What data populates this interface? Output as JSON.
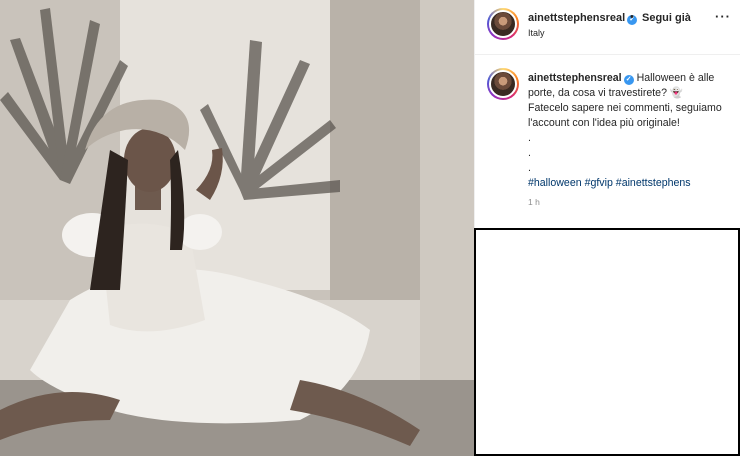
{
  "post": {
    "image_alt": "",
    "username": "ainettstephensreal",
    "verified": true,
    "separator": "•",
    "follow_label": "Segui già",
    "more_label": "···",
    "location": "Italy"
  },
  "caption": {
    "username": "ainettstephensreal",
    "text_line1": "Halloween è alle porte, da cosa vi travestirete? 👻",
    "text_line2": "Fatecelo sapere nei commenti, seguiamo l'account con l'idea più originale!",
    "dots": [
      ".",
      ".",
      "."
    ],
    "hashtags": [
      "#halloween",
      "#gfvip",
      "#ainettstephens"
    ]
  },
  "timestamp": "1 h",
  "colors": {
    "link": "#00376b",
    "verified": "#3897f0",
    "muted": "#8e8e8e",
    "text": "#262626"
  },
  "icons": {
    "verified": "verified-badge-icon",
    "more": "more-options-icon"
  }
}
